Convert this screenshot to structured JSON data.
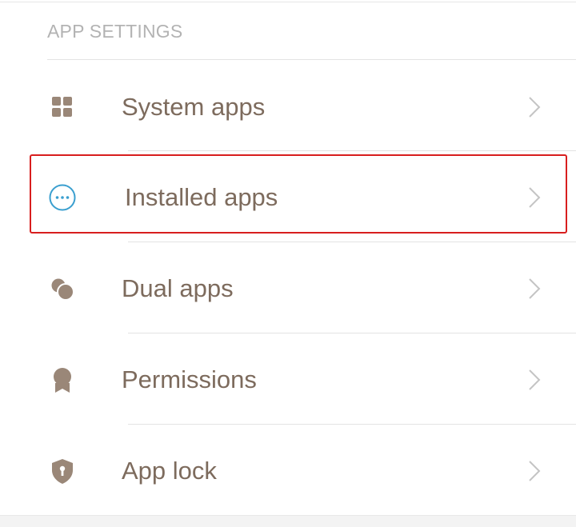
{
  "section": {
    "header": "APP SETTINGS"
  },
  "items": [
    {
      "label": "System apps",
      "icon": "grid-icon"
    },
    {
      "label": "Installed apps",
      "icon": "more-dots-circle-icon",
      "highlighted": true
    },
    {
      "label": "Dual apps",
      "icon": "dual-circles-icon"
    },
    {
      "label": "Permissions",
      "icon": "badge-icon"
    },
    {
      "label": "App lock",
      "icon": "shield-lock-icon"
    }
  ],
  "colors": {
    "label": "#7d6b5d",
    "icon": "#9a8778",
    "accent_icon": "#3a9fcf",
    "header": "#b3b3b3",
    "highlight_border": "#d81e1e",
    "chevron": "#c4c4c4"
  }
}
